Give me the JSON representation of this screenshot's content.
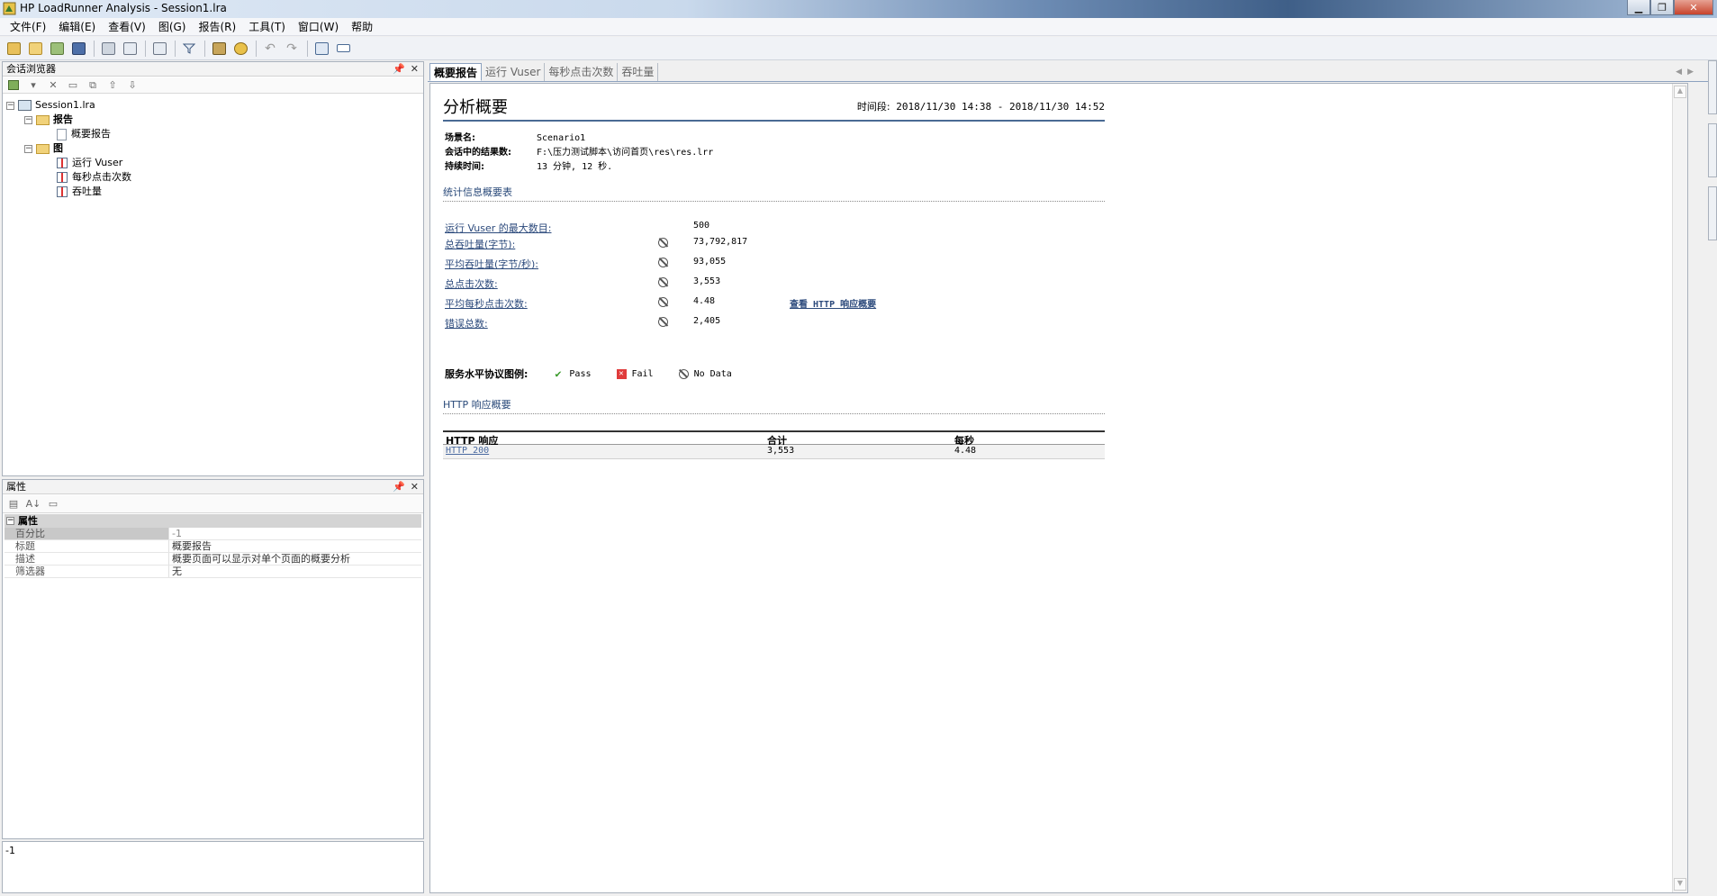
{
  "window": {
    "title": "HP LoadRunner Analysis - Session1.lra"
  },
  "menu": [
    "文件(F)",
    "编辑(E)",
    "查看(V)",
    "图(G)",
    "报告(R)",
    "工具(T)",
    "窗口(W)",
    "帮助"
  ],
  "session_browser": {
    "title": "会话浏览器",
    "tree": {
      "session": "Session1.lra",
      "reports_folder": "报告",
      "summary_report": "概要报告",
      "graphs_folder": "图",
      "graphs": [
        "运行 Vuser",
        "每秒点击次数",
        "吞吐量"
      ]
    }
  },
  "properties": {
    "title": "属性",
    "category": "属性",
    "rows": [
      {
        "name": "百分比",
        "value": "-1"
      },
      {
        "name": "标题",
        "value": "概要报告"
      },
      {
        "name": "描述",
        "value": "概要页面可以显示对单个页面的概要分析"
      },
      {
        "name": "筛选器",
        "value": "无"
      }
    ],
    "description_value": "-1"
  },
  "tabs": [
    "概要报告",
    "运行 Vuser",
    "每秒点击次数",
    "吞吐量"
  ],
  "report": {
    "title": "分析概要",
    "period_label": "时间段:",
    "period_value": "2018/11/30 14:38 - 2018/11/30 14:52",
    "scenario_label": "场景名:",
    "scenario_value": "Scenario1",
    "result_label": "会话中的结果数:",
    "result_value": "F:\\压力测试脚本\\访问首页\\res\\res.lrr",
    "duration_label": "持续时间:",
    "duration_value": "13 分钟, 12 秒.",
    "stats_title": "统计信息概要表",
    "stats": [
      {
        "label": "运行 Vuser 的最大数目:",
        "value": "500",
        "icon": false
      },
      {
        "label": "总吞吐量(字节):",
        "value": "73,792,817",
        "icon": true
      },
      {
        "label": "平均吞吐量(字节/秒):",
        "value": "93,055",
        "icon": true
      },
      {
        "label": "总点击次数:",
        "value": "3,553",
        "icon": true
      },
      {
        "label": "平均每秒点击次数:",
        "value": "4.48",
        "icon": true
      },
      {
        "label": "错误总数:",
        "value": "2,405",
        "icon": true
      }
    ],
    "http_link": "查看 HTTP 响应概要",
    "sla_label": "服务水平协议图例:",
    "sla_pass": "Pass",
    "sla_fail": "Fail",
    "sla_nodata": "No Data",
    "http_title": "HTTP 响应概要",
    "http_columns": [
      "HTTP 响应",
      "合计",
      "每秒"
    ],
    "http_rows": [
      {
        "response": "HTTP 200",
        "total": "3,553",
        "per_sec": "4.48"
      }
    ]
  }
}
